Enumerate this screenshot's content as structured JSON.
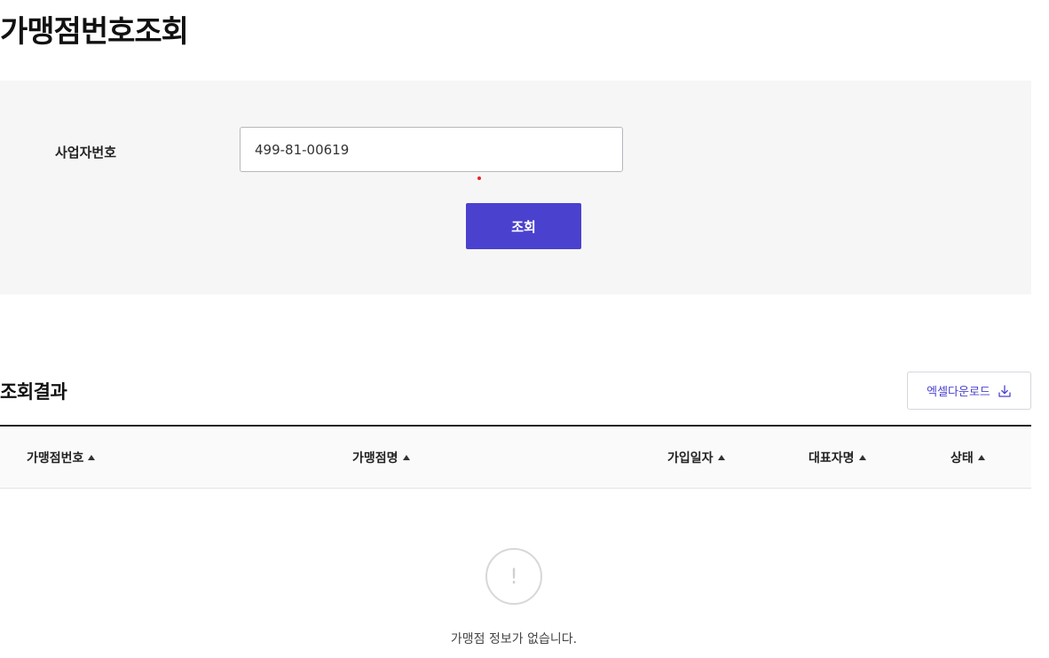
{
  "page": {
    "title": "가맹점번호조회"
  },
  "search": {
    "field_label": "사업자번호",
    "field_value": "499-81-00619",
    "button_label": "조회",
    "accent_color": "#4a41cf"
  },
  "results": {
    "title": "조회결과",
    "excel_button_label": "엑셀다운로드",
    "excel_icon": "download-icon",
    "columns": [
      {
        "label": "가맹점번호",
        "sort_icon": "sort-up-icon"
      },
      {
        "label": "가맹점명",
        "sort_icon": "sort-up-icon"
      },
      {
        "label": "가입일자",
        "sort_icon": "sort-up-icon"
      },
      {
        "label": "대표자명",
        "sort_icon": "sort-up-icon"
      },
      {
        "label": "상태",
        "sort_icon": "sort-up-icon"
      }
    ],
    "rows": [],
    "empty": {
      "icon": "exclamation-circle-icon",
      "icon_glyph": "!",
      "message": "가맹점 정보가 없습니다."
    }
  }
}
